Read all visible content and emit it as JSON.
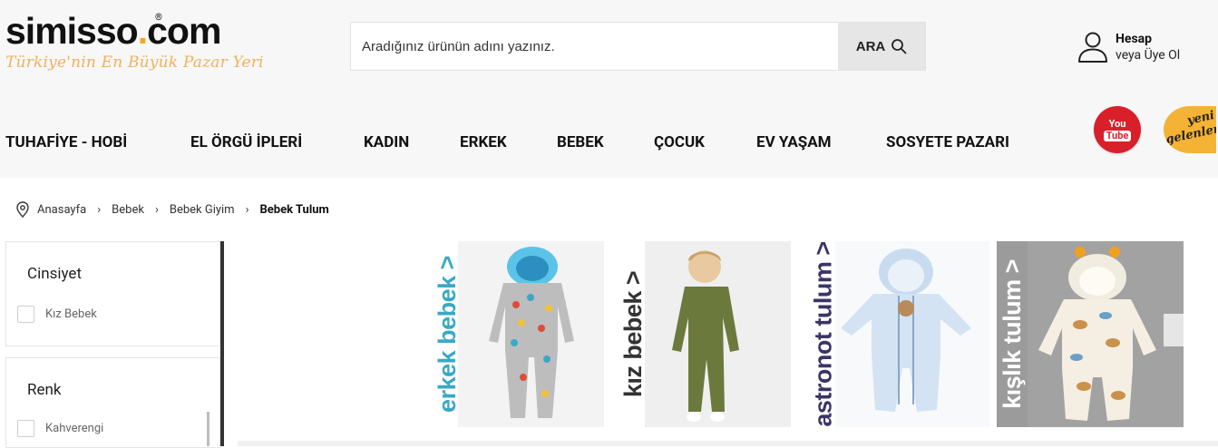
{
  "brand": {
    "name_main": "simisso",
    "name_dot": ".",
    "name_tld": "com",
    "registered": "®",
    "tagline": "Türkiye'nin En Büyük Pazar Yeri",
    "accent_color": "#f5a623"
  },
  "search": {
    "placeholder": "Aradığınız ürünün adını yazınız.",
    "button_label": "ARA",
    "button_icon": "search-icon"
  },
  "account": {
    "icon": "user-icon",
    "title": "Hesap",
    "subtitle": "veya Üye Ol"
  },
  "nav": {
    "items": [
      {
        "label": "TUHAFİYE - HOBİ"
      },
      {
        "label": "EL ÖRGÜ İPLERİ"
      },
      {
        "label": "KADIN"
      },
      {
        "label": "ERKEK"
      },
      {
        "label": "BEBEK"
      },
      {
        "label": "ÇOCUK"
      },
      {
        "label": "EV YAŞAM"
      },
      {
        "label": "SOSYETE PAZARI"
      }
    ],
    "youtube": {
      "line1": "You",
      "line2": "Tube"
    },
    "yeni": {
      "line1": "yeni",
      "line2": "gelenler"
    }
  },
  "breadcrumb": {
    "icon": "location-pin-icon",
    "items": [
      "Anasayfa",
      "Bebek",
      "Bebek Giyim"
    ],
    "current": "Bebek Tulum",
    "separator": "›"
  },
  "filters": [
    {
      "title": "Cinsiyet",
      "options": [
        "Kız Bebek"
      ]
    },
    {
      "title": "Renk",
      "options": [
        "Kahverengi"
      ]
    }
  ],
  "banners": [
    {
      "label": "erkek bebek >",
      "color": "#3aa8c7"
    },
    {
      "label": "kız bebek >",
      "color": "#333333"
    },
    {
      "label": "astronot tulum >",
      "color": "#3b3565"
    },
    {
      "label": "kışlık tulum >",
      "color": "#ffffff"
    }
  ]
}
